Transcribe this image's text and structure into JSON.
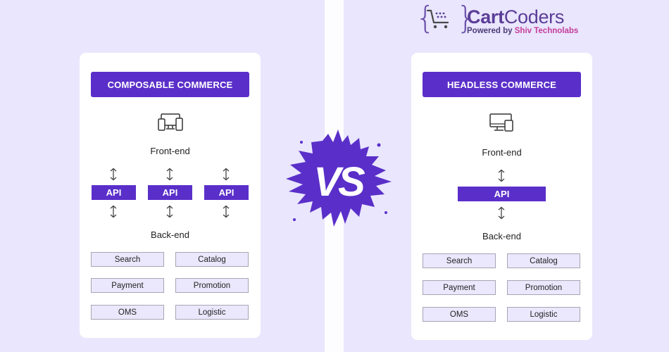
{
  "logo": {
    "brand_bold": "Cart",
    "brand_light": "Coders",
    "tagline_prefix": "Powered by ",
    "tagline_highlight": "Shiv Technolabs",
    "icon": "shopping-cart-icon"
  },
  "vs_label": "VS",
  "colors": {
    "accent": "#5a2fc9",
    "background": "#e9e6fd",
    "module_fill": "#ebe8fd",
    "brand_purple": "#5b3d97",
    "brand_pink": "#c53c9a"
  },
  "composable": {
    "title": "COMPOSABLE COMMERCE",
    "frontend_label": "Front-end",
    "frontend_icon": "devices-icon",
    "apis": [
      "API",
      "API",
      "API"
    ],
    "backend_label": "Back-end",
    "modules": [
      "Search",
      "Catalog",
      "Payment",
      "Promotion",
      "OMS",
      "Logistic"
    ]
  },
  "headless": {
    "title": "HEADLESS COMMERCE",
    "frontend_label": "Front-end",
    "frontend_icon": "monitor-phone-icon",
    "apis": [
      "API"
    ],
    "backend_label": "Back-end",
    "modules": [
      "Search",
      "Catalog",
      "Payment",
      "Promotion",
      "OMS",
      "Logistic"
    ]
  }
}
